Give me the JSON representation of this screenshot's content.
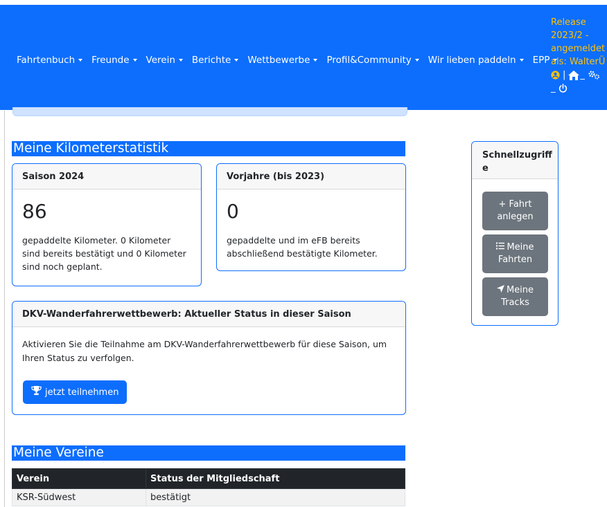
{
  "navbar": {
    "items": [
      {
        "label": "Fahrtenbuch"
      },
      {
        "label": "Freunde"
      },
      {
        "label": "Verein"
      },
      {
        "label": "Berichte"
      },
      {
        "label": "Wettbewerbe"
      },
      {
        "label": "Profil&Community"
      },
      {
        "label": "Wir lieben paddeln"
      },
      {
        "label": "EPP"
      }
    ],
    "release": {
      "line1": "Release",
      "line2": "2023/2 -",
      "line3": "angemeldet",
      "line4": "als: WalterÜ",
      "sep": "|",
      "underscore1": "_",
      "underscore2": "_"
    }
  },
  "stats": {
    "section_title": "Meine Kilometerstatistik",
    "season": {
      "header": "Saison 2024",
      "number": "86",
      "text": "gepaddelte Kilometer. 0 Kilometer sind bereits bestätigt und 0 Kilometer sind noch geplant."
    },
    "previous": {
      "header": "Vorjahre (bis 2023)",
      "number": "0",
      "text": "gepaddelte und im eFB bereits abschließend bestätigte Kilometer."
    }
  },
  "dkv": {
    "header": "DKV-Wanderfahrerwettbewerb: Aktueller Status in dieser Saison",
    "text": "Aktivieren Sie die Teilnahme am DKV-Wanderfahrerwettbewerb für diese Saison, um Ihren Status zu verfolgen.",
    "button": "jetzt teilnehmen"
  },
  "quick": {
    "header": "Schnellzugriffe",
    "buttons": [
      {
        "icon": "plus-icon",
        "line1": "+ Fahrt",
        "line2": "anlegen"
      },
      {
        "icon": "list-icon",
        "line1": "Meine",
        "line2": "Fahrten"
      },
      {
        "icon": "location-arrow-icon",
        "line1": "Meine",
        "line2": "Tracks"
      }
    ]
  },
  "vereine": {
    "section_title": "Meine Vereine",
    "columns": [
      "Verein",
      "Status der Mitgliedschaft"
    ],
    "rows": [
      [
        "KSR-Südwest",
        "bestätigt"
      ]
    ]
  },
  "colors": {
    "primary": "#0d6efd",
    "warning": "#ffc107",
    "secondary": "#6c757d",
    "dark": "#212529"
  }
}
